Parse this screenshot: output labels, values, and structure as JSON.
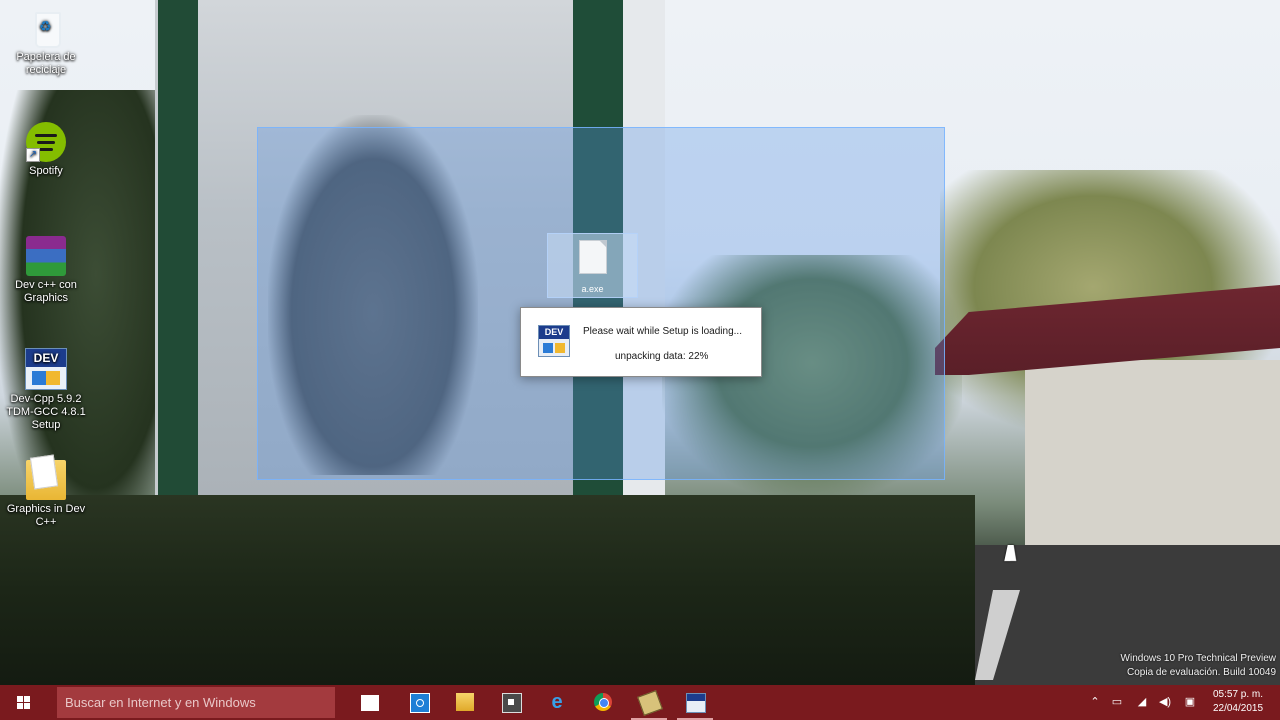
{
  "desktop": {
    "icons": [
      {
        "label": "Papelera de reciclaje",
        "icon": "recycle-bin-icon"
      },
      {
        "label": "Spotify",
        "icon": "spotify-icon"
      },
      {
        "label": "Dev c++ con Graphics",
        "icon": "winrar-archive-icon"
      },
      {
        "label": "Dev-Cpp 5.9.2 TDM-GCC 4.8.1 Setup",
        "icon": "devcpp-setup-icon"
      },
      {
        "label": "Graphics in Dev C++",
        "icon": "folder-icon"
      }
    ]
  },
  "drag_file": {
    "label": "a.exe",
    "icon": "file-icon"
  },
  "setup_dialog": {
    "message": "Please wait while Setup is loading...",
    "status": "unpacking data: 22%",
    "progress_percent": 22,
    "icon": "devcpp-icon"
  },
  "watermark": {
    "line1": "Windows 10 Pro Technical Preview",
    "line2": "Copia de evaluación. Build 10049"
  },
  "taskbar": {
    "search_placeholder": "Buscar en Internet y en Windows",
    "pinned": [
      {
        "name": "task-view",
        "icon": "task-view-icon"
      },
      {
        "name": "store",
        "icon": "store-icon"
      },
      {
        "name": "file-explorer",
        "icon": "folder-icon"
      },
      {
        "name": "app",
        "icon": "app-window-icon"
      },
      {
        "name": "internet-explorer",
        "icon": "internet-explorer-icon"
      },
      {
        "name": "chrome",
        "icon": "chrome-icon"
      },
      {
        "name": "installer-package",
        "icon": "package-icon"
      },
      {
        "name": "devcpp-setup",
        "icon": "devcpp-icon"
      }
    ],
    "tray_icons": [
      "chevron-up-icon",
      "network-icon",
      "signal-icon",
      "volume-icon",
      "notification-icon"
    ],
    "clock": {
      "time": "05:57 p. m.",
      "date": "22/04/2015"
    },
    "accent_color": "#7a1a1e"
  }
}
